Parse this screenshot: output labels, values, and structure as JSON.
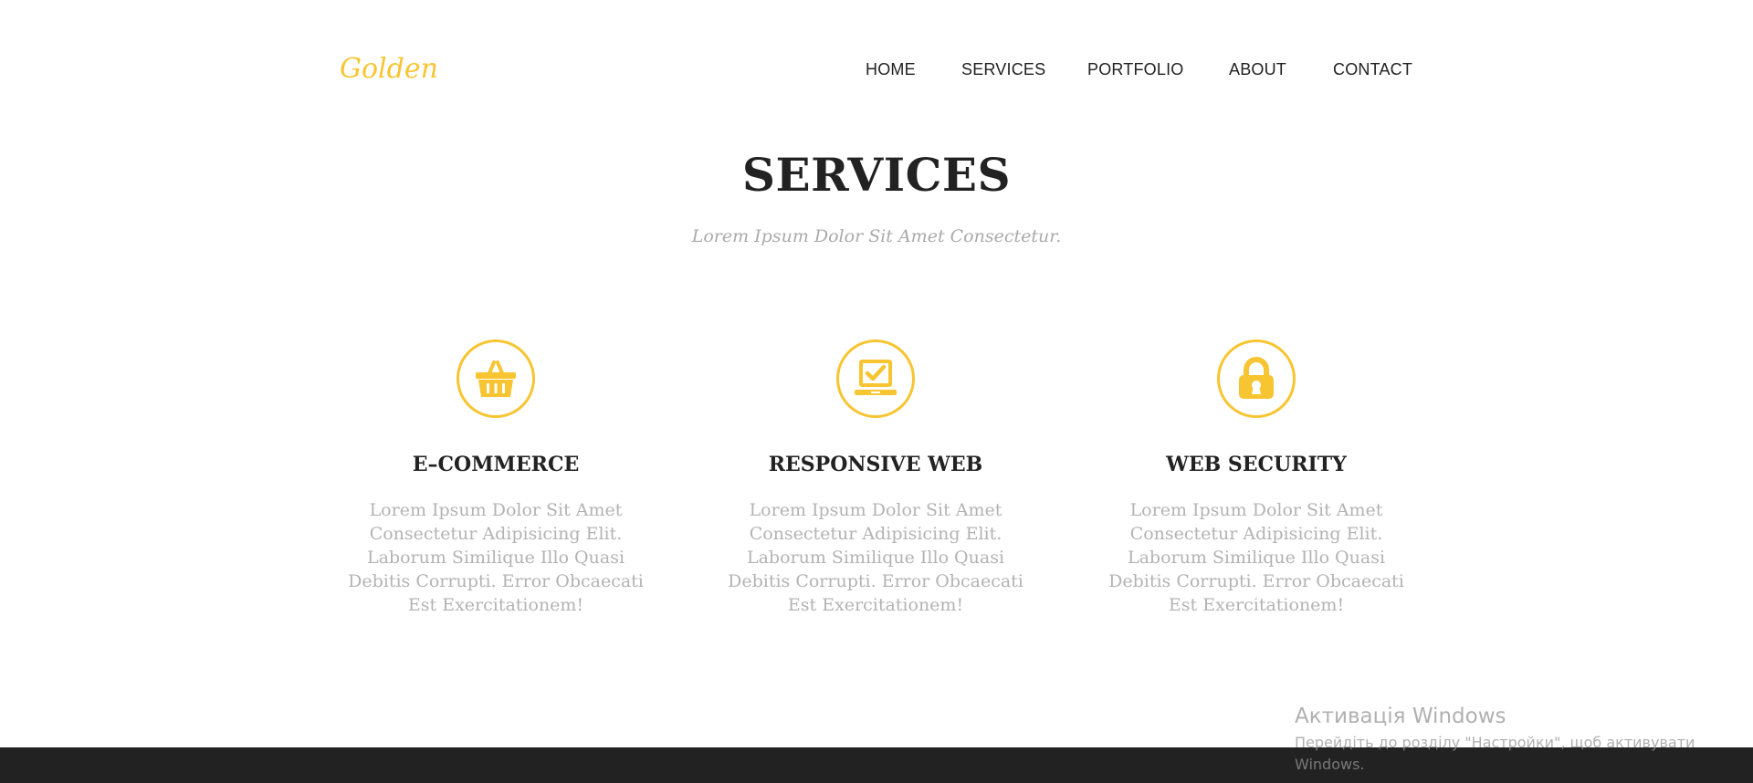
{
  "header": {
    "logo": "Golden",
    "nav": [
      "HOME",
      "SERVICES",
      "PORTFOLIO",
      "ABOUT",
      "CONTACT"
    ]
  },
  "section": {
    "title": "SERVICES",
    "subtitle": "Lorem Ipsum Dolor Sit Amet Consectetur."
  },
  "services": [
    {
      "icon": "basket-icon",
      "title": "E–COMMERCE",
      "text": "Lorem Ipsum Dolor Sit Amet Consectetur Adipisicing Elit. Laborum Similique Illo Quasi Debitis Corrupti. Error Obcaecati Est Exercitationem!"
    },
    {
      "icon": "laptop-check-icon",
      "title": "RESPONSIVE WEB",
      "text": "Lorem Ipsum Dolor Sit Amet Consectetur Adipisicing Elit. Laborum Similique Illo Quasi Debitis Corrupti. Error Obcaecati Est Exercitationem!"
    },
    {
      "icon": "lock-icon",
      "title": "WEB SECURITY",
      "text": "Lorem Ipsum Dolor Sit Amet Consectetur Adipisicing Elit. Laborum Similique Illo Quasi Debitis Corrupti. Error Obcaecati Est Exercitationem!"
    }
  ],
  "windows_watermark": {
    "title": "Активація Windows",
    "text": "Перейдіть до розділу \"Настройки\", щоб активувати Windows."
  },
  "colors": {
    "accent": "#f7c531",
    "heading": "#222222",
    "body_text": "#b3b3b3",
    "footer": "#222222"
  }
}
